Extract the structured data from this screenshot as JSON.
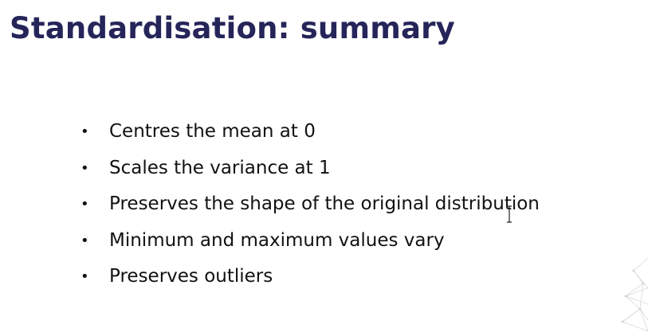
{
  "slide": {
    "title": "Standardisation: summary",
    "bullet_glyph": "•",
    "bullets": [
      "Centres the mean at 0",
      "Scales the variance at 1",
      "Preserves the shape of the original distribution",
      "Minimum and maximum values vary",
      "Preserves outliers"
    ]
  },
  "colors": {
    "title": "#26255a",
    "text": "#111111",
    "background": "#ffffff",
    "decoration": "#d8d8d8"
  },
  "icons": {
    "cursor": "text-cursor-icon",
    "corner_decoration": "network-mesh-icon"
  }
}
